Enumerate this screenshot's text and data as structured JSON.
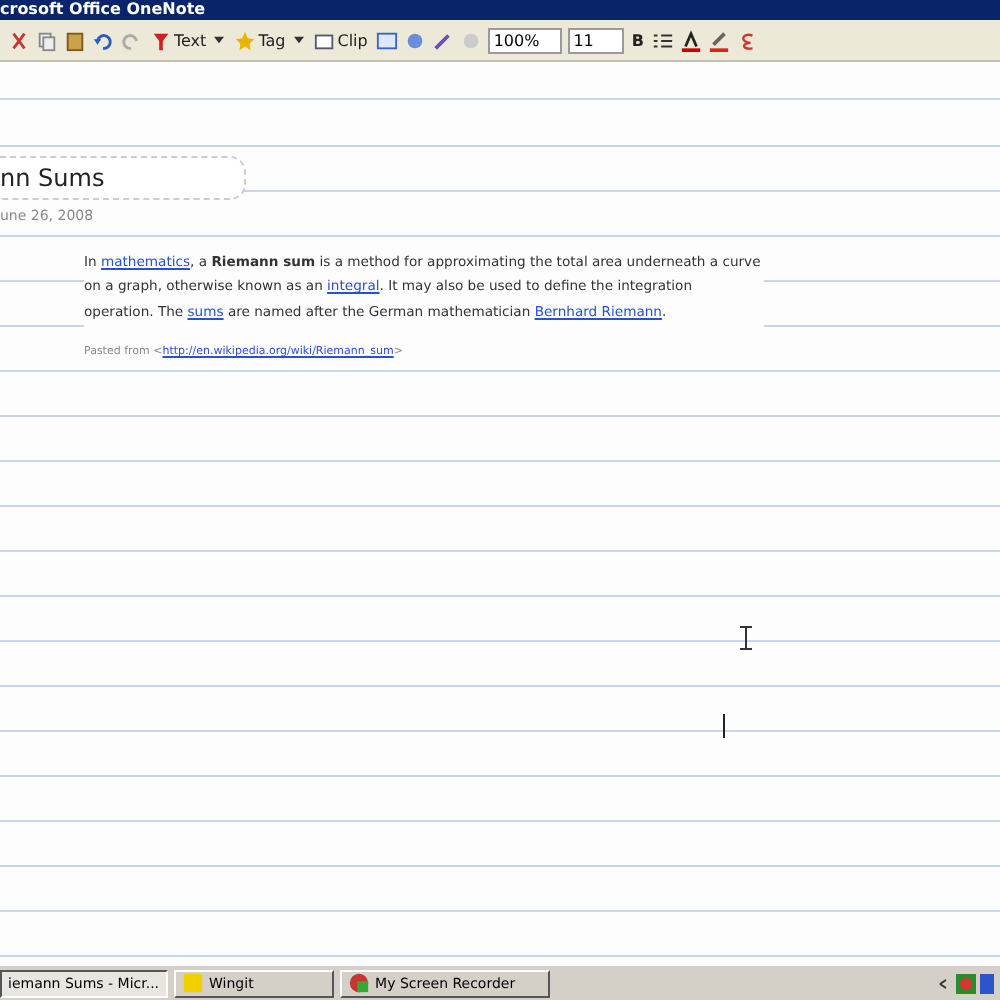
{
  "window": {
    "title": "crosoft Office OneNote"
  },
  "toolbar": {
    "buttons": [
      {
        "label": "Text"
      },
      {
        "label": "Tag"
      },
      {
        "label": "Clip"
      }
    ],
    "zoom": "100%",
    "font_size": "11",
    "bold": "B"
  },
  "page": {
    "title": "nn Sums",
    "date": "une 26, 2008",
    "paragraph": [
      {
        "kind": "text",
        "text": "In "
      },
      {
        "kind": "link",
        "text": "mathematics"
      },
      {
        "kind": "text",
        "text": ", a "
      },
      {
        "kind": "bold",
        "text": "Riemann sum"
      },
      {
        "kind": "text",
        "text": " is a method for approximating the total area underneath a curve on a graph, otherwise known as an "
      },
      {
        "kind": "link",
        "text": "integral"
      },
      {
        "kind": "text",
        "text": ". It may also be used to define the integration operation. The "
      },
      {
        "kind": "link",
        "text": "sums"
      },
      {
        "kind": "text",
        "text": " are named after the German mathematician "
      },
      {
        "kind": "link",
        "text": "Bernhard Riemann"
      },
      {
        "kind": "text",
        "text": "."
      }
    ],
    "source": {
      "prefix": "Pasted from <",
      "url": "http://en.wikipedia.org/wiki/Riemann_sum",
      "suffix": ">"
    }
  },
  "taskbar": {
    "items": [
      {
        "label": "iemann Sums - Micr...",
        "selected": true
      },
      {
        "label": "Wingit",
        "selected": false
      },
      {
        "label": "My Screen Recorder",
        "selected": false
      }
    ]
  }
}
